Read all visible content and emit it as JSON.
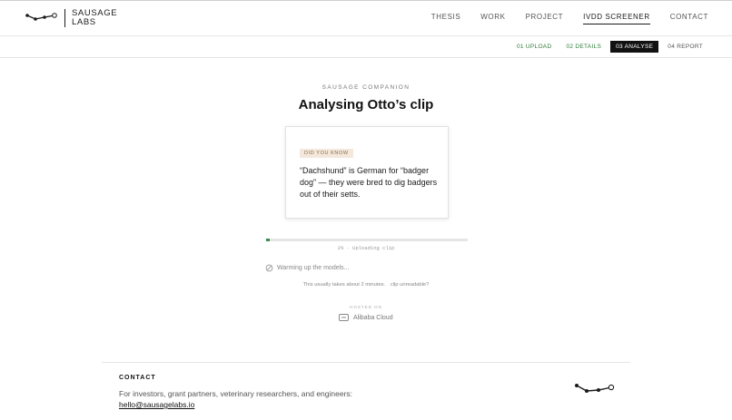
{
  "header": {
    "logo_line1": "SAUSAGE",
    "logo_line2": "LABS",
    "nav": [
      {
        "label": "THESIS"
      },
      {
        "label": "WORK"
      },
      {
        "label": "PROJECT"
      },
      {
        "label": "IVDD SCREENER",
        "active": true
      },
      {
        "label": "CONTACT"
      }
    ]
  },
  "steps": [
    {
      "label": "01 UPLOAD",
      "state": "done"
    },
    {
      "label": "02 DETAILS",
      "state": "done"
    },
    {
      "label": "03 ANALYSE",
      "state": "active"
    },
    {
      "label": "04 REPORT",
      "state": "todo"
    }
  ],
  "main": {
    "eyebrow": "SAUSAGE COMPANION",
    "title": "Analysing Otto’s clip",
    "card": {
      "tag": "DID YOU KNOW",
      "fact": "“Dachshund” is German for “badger dog” — they were bred to dig badgers out of their setts."
    },
    "progress": {
      "percent": 2,
      "label": "2% · Uploading clip"
    },
    "status_text": "Warming up the models...",
    "hint_text": "This usually takes about 2 minutes.",
    "hint_link": "clip unreadable?",
    "hosted_label": "HOSTED ON",
    "hosted_provider": "Alibaba Cloud"
  },
  "footer": {
    "heading": "CONTACT",
    "text": "For investors, grant partners, veterinary researchers, and engineers:",
    "email": "hello@sausagelabs.io"
  },
  "colors": {
    "accent_green": "#3d8b4f",
    "active_step_bg": "#111111",
    "tag_bg": "#f4e8dc"
  },
  "icons": {
    "logo": "sausage-dog-logo-icon",
    "status": "paw-loading-icon",
    "hosted": "cloud-icon"
  }
}
